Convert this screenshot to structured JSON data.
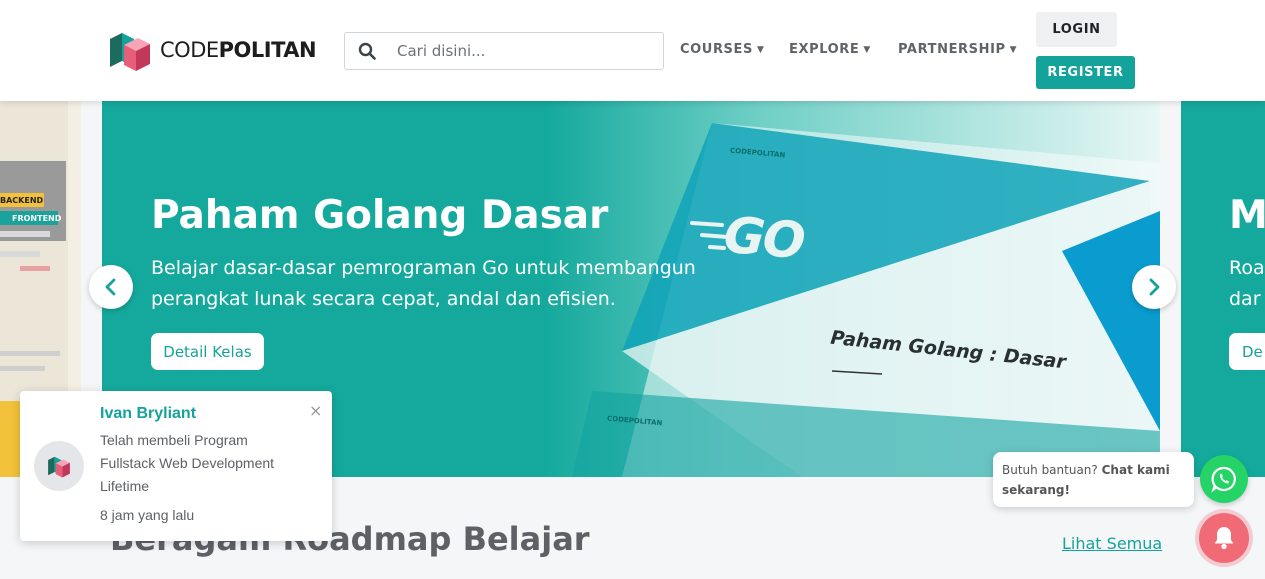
{
  "header": {
    "logo_plain": "CODE",
    "logo_bold": "POLITAN",
    "search_placeholder": "Cari disini...",
    "nav": [
      {
        "label": "COURSES"
      },
      {
        "label": "EXPLORE"
      },
      {
        "label": "PARTNERSHIP"
      }
    ],
    "login_label": "LOGIN",
    "register_label": "REGISTER"
  },
  "carousel": {
    "prev_slide": {
      "tag_backend": "BACKEND",
      "tag_frontend": "FRONTEND"
    },
    "current": {
      "title": "Paham Golang Dasar",
      "description": "Belajar dasar-dasar pemrograman Go untuk membangun perangkat lunak secara cepat, andal dan efisien.",
      "button": "Detail Kelas",
      "cover_brand": "CODEPOLITAN",
      "cover_logo": "GO",
      "cover_title": "Paham Golang : Dasar"
    },
    "next_slide": {
      "title": "M",
      "desc_line1": "Roa",
      "desc_line2": "dar",
      "button": "De"
    },
    "colors": {
      "accent": "#14a39a",
      "slide_bg": "#15a99d"
    }
  },
  "section": {
    "title": "Beragam Roadmap Belajar",
    "see_all": "Lihat Semua"
  },
  "toast": {
    "name": "Ivan Bryliant",
    "message": "Telah membeli Program Fullstack Web Development Lifetime",
    "time": "8 jam yang lalu",
    "close": "×"
  },
  "chat": {
    "prompt": "Butuh bantuan?",
    "cta": "Chat kami sekarang!"
  },
  "icons": [
    "search-icon",
    "caret-down-icon",
    "chevron-left-icon",
    "chevron-right-icon",
    "close-icon",
    "whatsapp-icon",
    "bell-icon"
  ]
}
